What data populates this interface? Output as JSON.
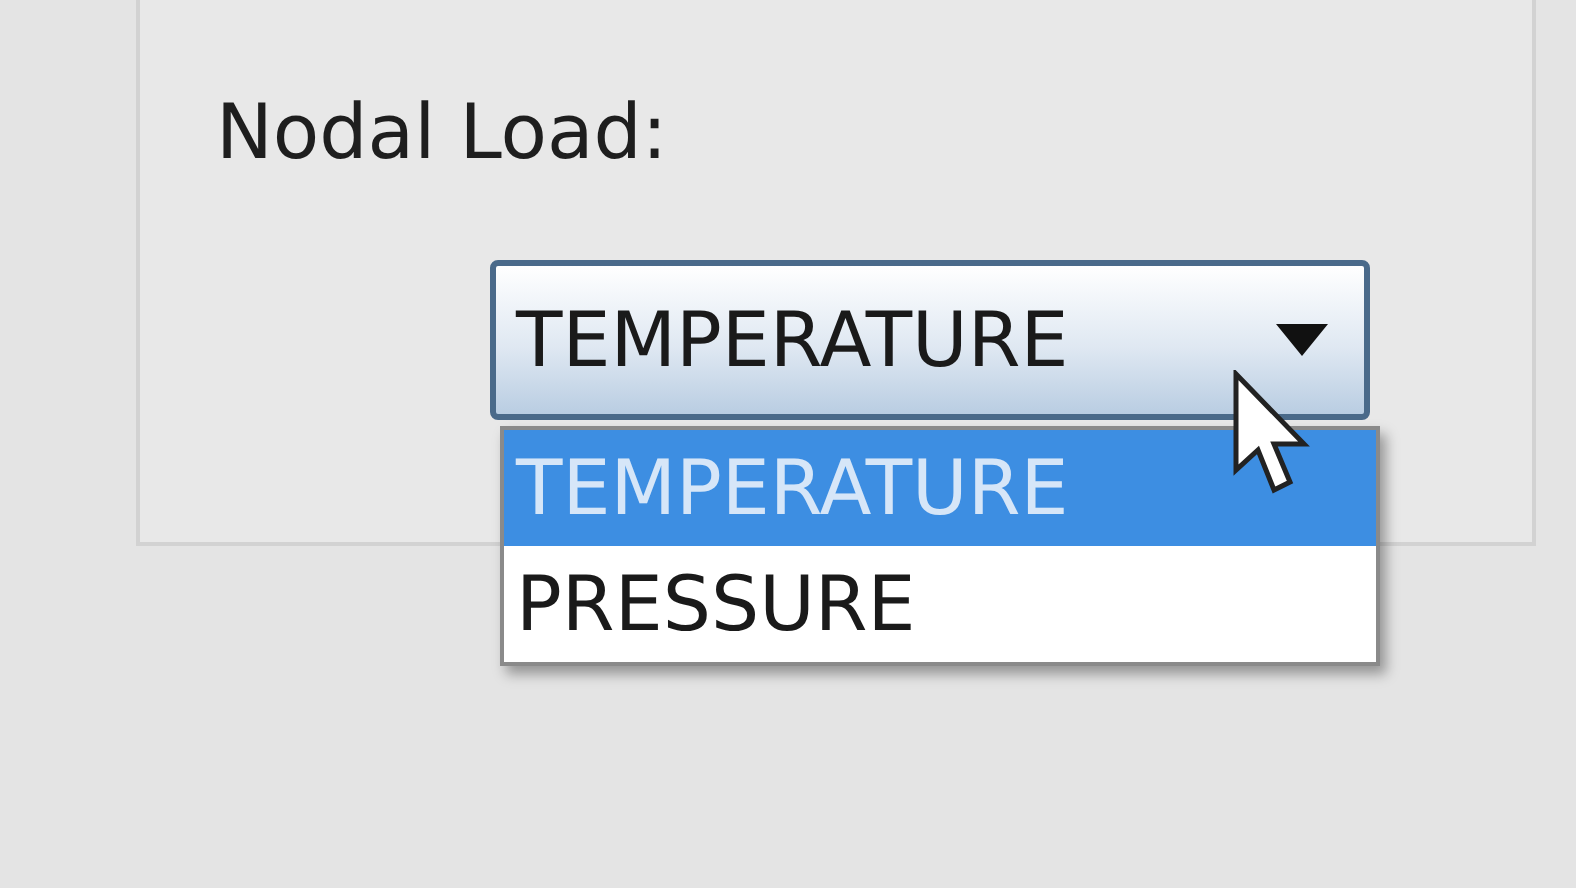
{
  "label": "Nodal Load:",
  "combo": {
    "value": "TEMPERATURE",
    "expanded": true
  },
  "options": [
    {
      "label": "TEMPERATURE",
      "selected": true
    },
    {
      "label": "PRESSURE",
      "selected": false
    }
  ]
}
